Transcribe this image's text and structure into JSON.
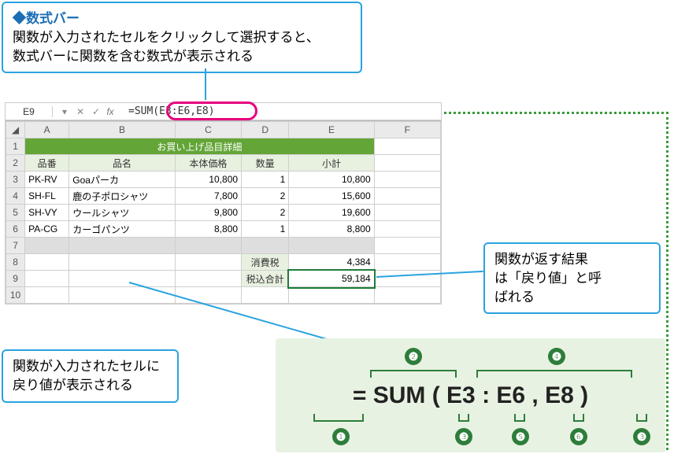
{
  "callout_top": {
    "title": "◆数式バー",
    "line1": "関数が入力されたセルをクリックして選択すると、",
    "line2": "数式バーに関数を含む数式が表示される"
  },
  "callout_right": {
    "line1": "関数が返す結果",
    "line2": "は「戻り値」と呼",
    "line3": "ばれる"
  },
  "callout_bottom": {
    "line1": "関数が入力されたセルに",
    "line2": "戻り値が表示される"
  },
  "excel": {
    "name_box": "E9",
    "formula": "=SUM(E3:E6,E8)",
    "col_headers": [
      "A",
      "B",
      "C",
      "D",
      "E",
      "F"
    ],
    "title_row": "お買い上げ品目詳細",
    "subheaders": [
      "品番",
      "品名",
      "本体価格",
      "数量",
      "小計"
    ],
    "rows": [
      {
        "n": "3",
        "a": "PK-RV",
        "b": "Goaパーカ",
        "c": "10,800",
        "d": "1",
        "e": "10,800"
      },
      {
        "n": "4",
        "a": "SH-FL",
        "b": "鹿の子ポロシャツ",
        "c": "7,800",
        "d": "2",
        "e": "15,600"
      },
      {
        "n": "5",
        "a": "SH-VY",
        "b": "ウールシャツ",
        "c": "9,800",
        "d": "2",
        "e": "19,600"
      },
      {
        "n": "6",
        "a": "PA-CG",
        "b": "カーゴパンツ",
        "c": "8,800",
        "d": "1",
        "e": "8,800"
      }
    ],
    "tax_label": "消費税",
    "tax_value": "4,384",
    "total_label": "税込合計",
    "total_value": "59,184"
  },
  "breakdown": {
    "formula": "= SUM ( E3 : E6 , E8 )",
    "labels": {
      "n1": "❶",
      "n2": "❷",
      "n3": "❸",
      "n4": "❹",
      "n5": "❺",
      "n6": "❻"
    }
  }
}
